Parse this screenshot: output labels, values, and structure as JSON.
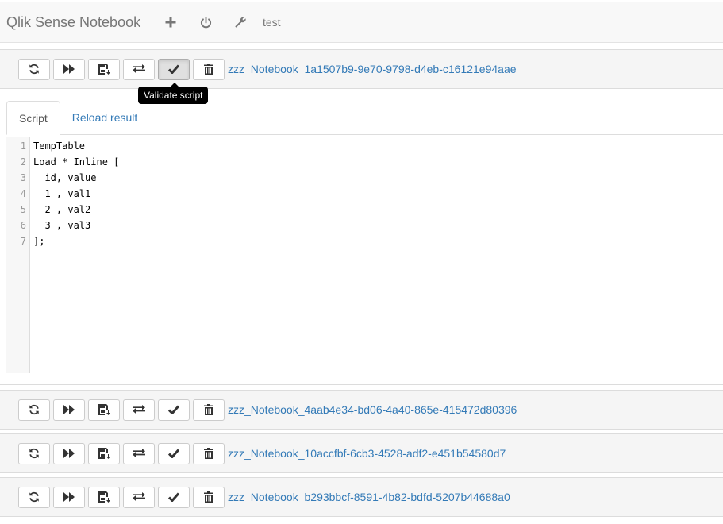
{
  "navbar": {
    "brand": "Qlik Sense Notebook",
    "icons": [
      "plus-icon",
      "power-icon",
      "wrench-icon"
    ],
    "user": "test"
  },
  "cells": [
    {
      "title": "zzz_Notebook_1a1507b9-9e70-9798-d4eb-c16121e94aae"
    },
    {
      "title": "zzz_Notebook_4aab4e34-bd06-4a40-865e-415472d80396"
    },
    {
      "title": "zzz_Notebook_10accfbf-6cb3-4528-adf2-e451b54580d7"
    },
    {
      "title": "zzz_Notebook_b293bbcf-8591-4b82-bdfd-5207b44688a0"
    }
  ],
  "toolbar_icons": [
    "refresh-icon",
    "fast-forward-icon",
    "save-icon",
    "transfer-icon",
    "check-icon",
    "trash-icon"
  ],
  "tooltip": "Validate script",
  "tabs": [
    "Script",
    "Reload result"
  ],
  "script": {
    "line_numbers": [
      "1",
      "2",
      "3",
      "4",
      "5",
      "6",
      "7"
    ],
    "lines": [
      "TempTable",
      "Load * Inline [",
      "  id, value",
      "  1 , val1",
      "  2 , val2",
      "  3 , val3",
      "];"
    ]
  },
  "colors": {
    "link": "#337ab7",
    "navbar_bg": "#f8f8f8",
    "cell_header_bg": "#f5f5f5"
  }
}
